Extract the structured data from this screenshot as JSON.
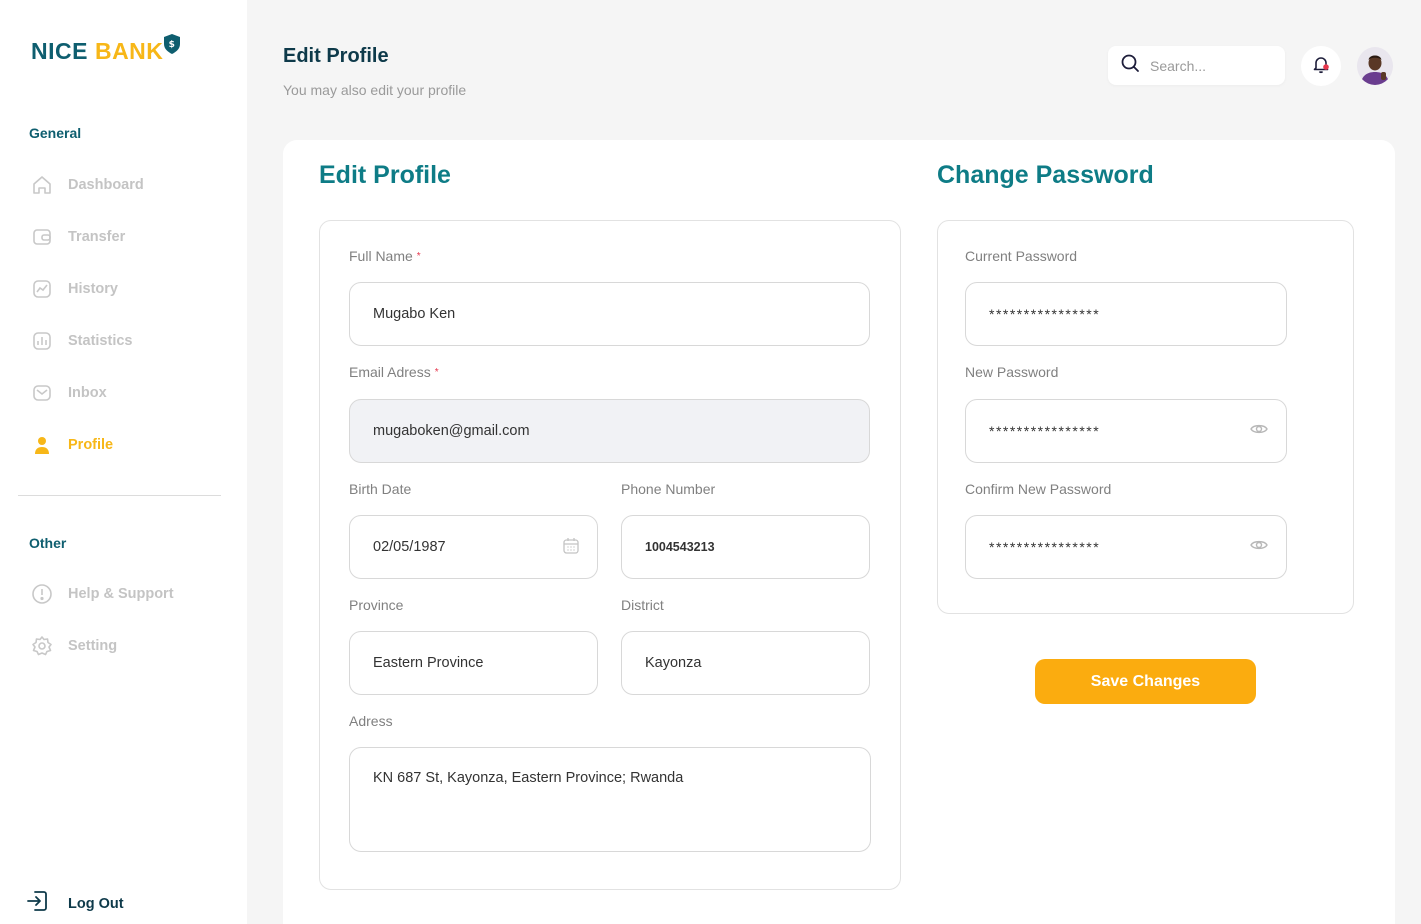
{
  "brand": {
    "name_part1": "NICE",
    "name_part2": "BANK",
    "colors": {
      "primary": "#0e5e6f",
      "accent": "#f7b718"
    }
  },
  "sidebar": {
    "general_label": "General",
    "items": [
      {
        "label": "Dashboard",
        "icon": "home-icon"
      },
      {
        "label": "Transfer",
        "icon": "wallet-icon"
      },
      {
        "label": "History",
        "icon": "chart-line-icon"
      },
      {
        "label": "Statistics",
        "icon": "bar-chart-icon"
      },
      {
        "label": "Inbox",
        "icon": "mail-icon"
      },
      {
        "label": "Profile",
        "icon": "user-icon",
        "active": true
      }
    ],
    "other_label": "Other",
    "other_items": [
      {
        "label": "Help & Support",
        "icon": "info-icon"
      },
      {
        "label": "Setting",
        "icon": "gear-icon"
      }
    ],
    "logout_label": "Log Out"
  },
  "header": {
    "title": "Edit Profile",
    "subtitle": "You may also edit your profile",
    "search_placeholder": "Search..."
  },
  "profile": {
    "title": "Edit Profile",
    "full_name_label": "Full Name",
    "full_name": "Mugabo Ken",
    "email_label": "Email Adress",
    "email": "mugaboken@gmail.com",
    "birth_label": "Birth Date",
    "birth": "02/05/1987",
    "phone_label": "Phone Number",
    "phone": "1004543213",
    "province_label": "Province",
    "province": "Eastern Province",
    "district_label": "District",
    "district": "Kayonza",
    "address_label": "Adress",
    "address": "KN 687 St, Kayonza, Eastern Province; Rwanda",
    "required_mark": "*"
  },
  "password": {
    "title": "Change Password",
    "current_label": "Current Password",
    "current": "****************",
    "new_label": "New Password",
    "new": "****************",
    "confirm_label": "Confirm New Password",
    "confirm": "****************"
  },
  "save_label": "Save Changes"
}
